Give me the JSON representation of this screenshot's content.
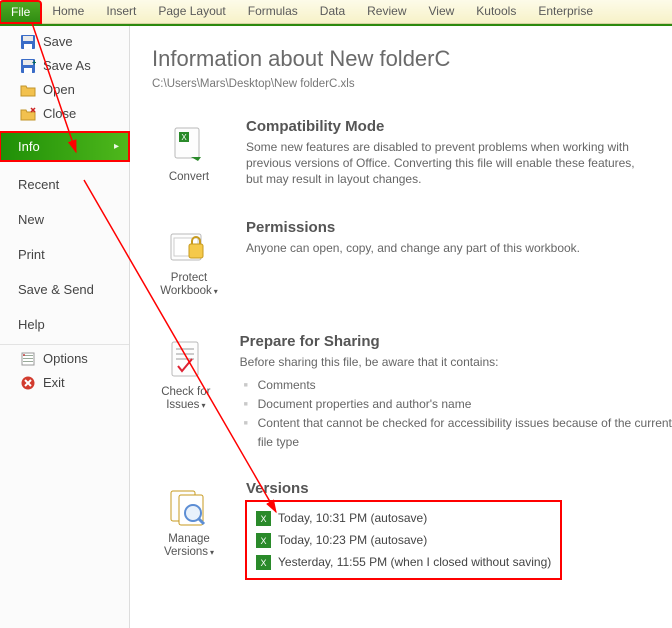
{
  "ribbon": [
    "File",
    "Home",
    "Insert",
    "Page Layout",
    "Formulas",
    "Data",
    "Review",
    "View",
    "Kutools",
    "Enterprise"
  ],
  "sidebar": {
    "items": [
      {
        "icon": "save",
        "label": "Save"
      },
      {
        "icon": "saveas",
        "label": "Save As"
      },
      {
        "icon": "open",
        "label": "Open"
      },
      {
        "icon": "close",
        "label": "Close"
      }
    ],
    "info": "Info",
    "sections": [
      "Recent",
      "New",
      "Print",
      "Save & Send",
      "Help"
    ],
    "footer": [
      {
        "icon": "options",
        "label": "Options"
      },
      {
        "icon": "exit",
        "label": "Exit"
      }
    ]
  },
  "content": {
    "title": "Information about New folderC",
    "path": "C:\\Users\\Mars\\Desktop\\New folderC.xls",
    "compat": {
      "heading": "Compatibility Mode",
      "text": "Some new features are disabled to prevent problems when working with previous versions of Office. Converting this file will enable these features, but may result in layout changes.",
      "button": "Convert"
    },
    "perm": {
      "heading": "Permissions",
      "text": "Anyone can open, copy, and change any part of this workbook.",
      "button": "Protect Workbook"
    },
    "prepare": {
      "heading": "Prepare for Sharing",
      "text": "Before sharing this file, be aware that it contains:",
      "items": [
        "Comments",
        "Document properties and author's name",
        "Content that cannot be checked for accessibility issues because of the current file type"
      ],
      "button": "Check for Issues"
    },
    "versions": {
      "heading": "Versions",
      "items": [
        "Today, 10:31 PM (autosave)",
        "Today, 10:23 PM (autosave)",
        "Yesterday, 11:55 PM (when I closed without saving)"
      ],
      "button": "Manage Versions"
    }
  }
}
